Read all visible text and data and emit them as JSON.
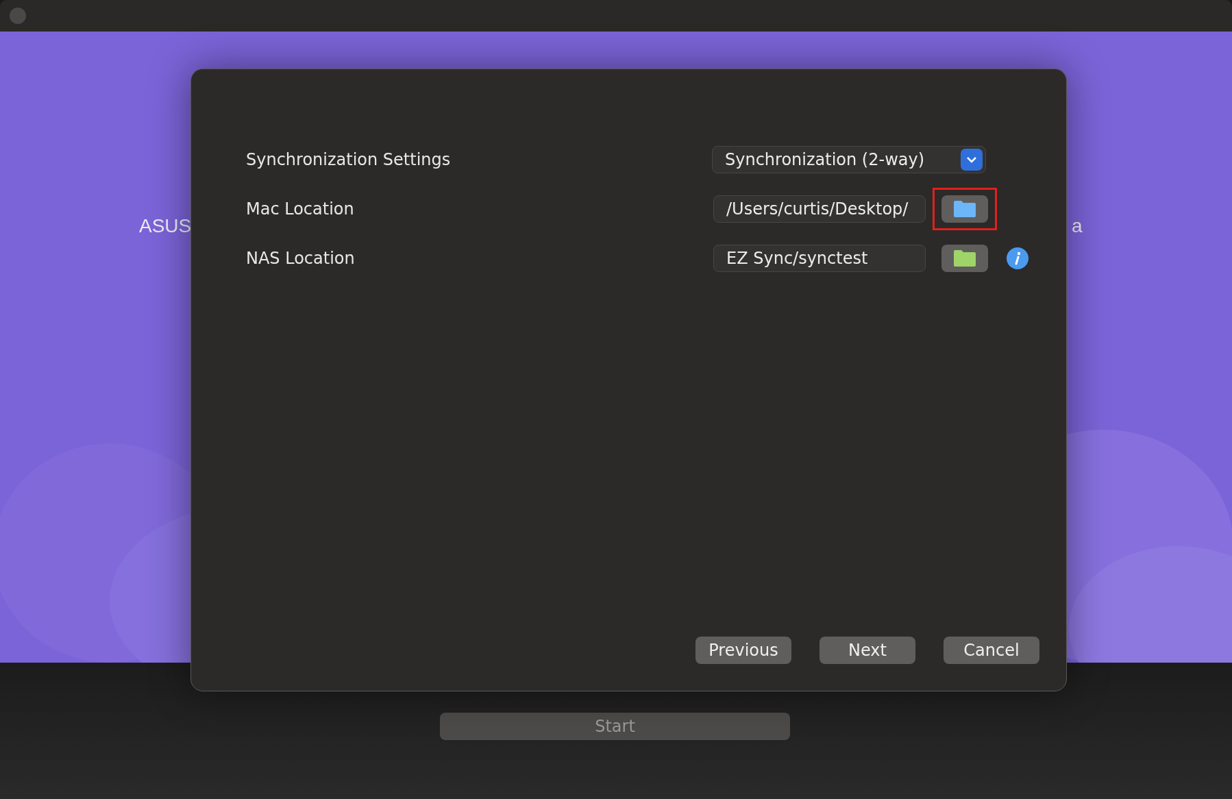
{
  "background_text": [
    "ASUS",
    "a"
  ],
  "dialog": {
    "rows": [
      {
        "kind": "dropdown",
        "label": "Synchronization Settings",
        "value": "Synchronization (2-way)"
      },
      {
        "kind": "path",
        "label": "Mac Location",
        "value": "/Users/curtis/Desktop/",
        "color": "#6cb6f9",
        "highlighted": true,
        "info": false
      },
      {
        "kind": "path",
        "label": "NAS Location",
        "value": "EZ Sync/synctest",
        "color": "#9fd468",
        "highlighted": false,
        "info": true
      }
    ],
    "buttons": [
      "Previous",
      "Next",
      "Cancel"
    ]
  },
  "start": {
    "label": "Start",
    "disabled": true
  }
}
